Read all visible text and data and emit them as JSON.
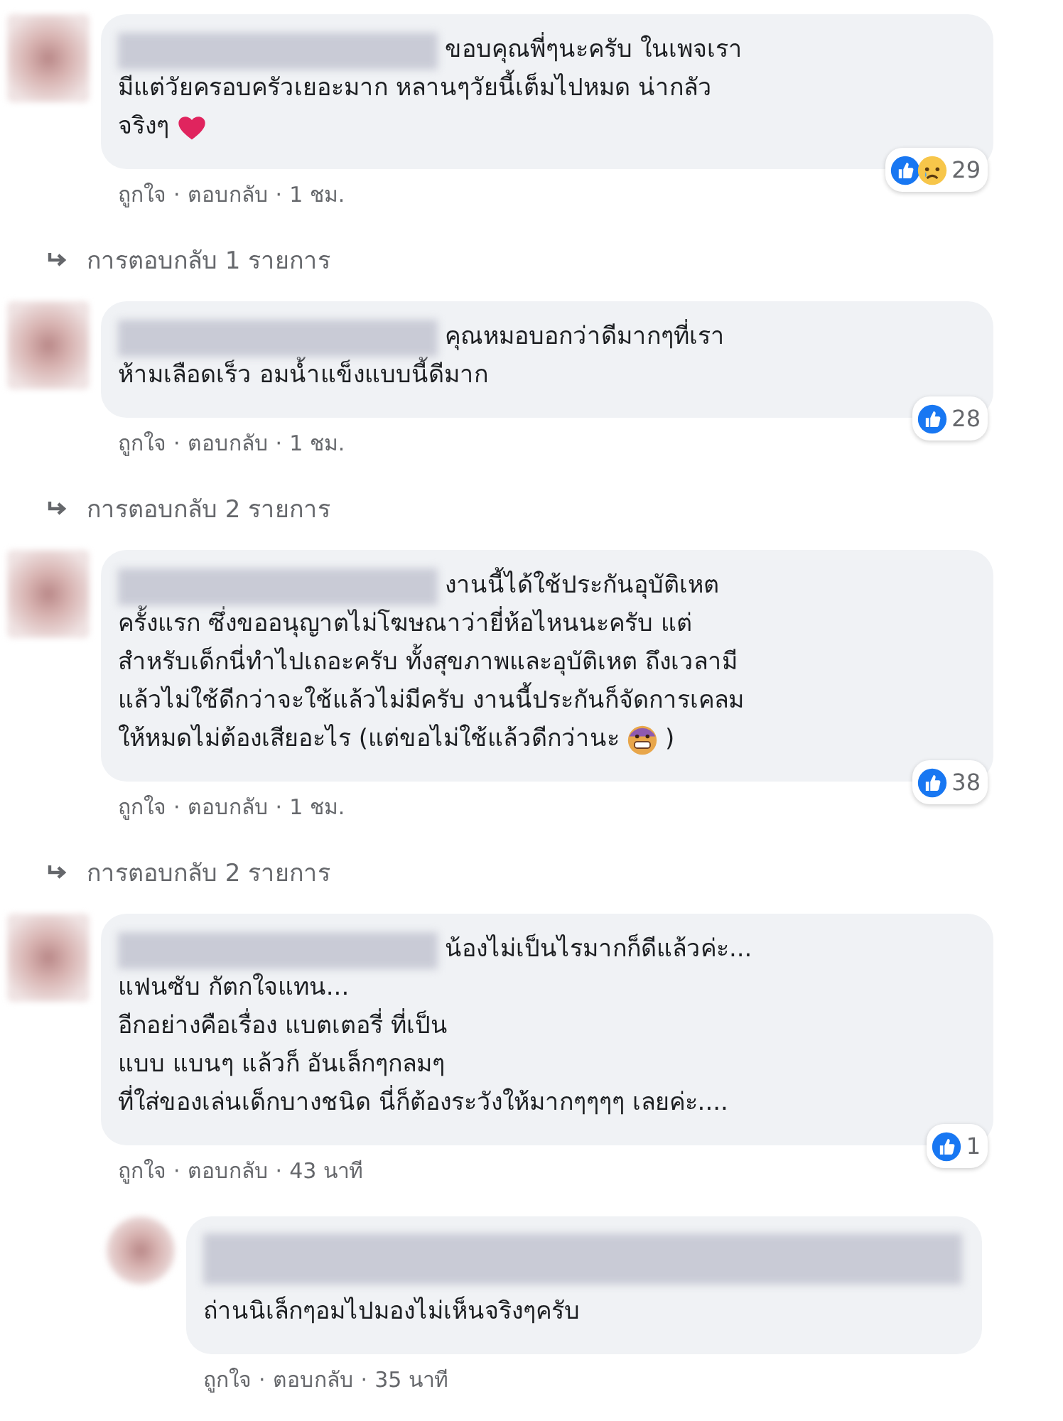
{
  "comments": [
    {
      "lines": [
        [
          {
            "kind": "text",
            "text": "ขอบคุณพี่ๆนะครับ ในเพจเรา"
          }
        ],
        [
          {
            "kind": "text",
            "text": "มีแต่วัยครอบครัวเยอะมาก หลานๆวัยนี้เต็มไปหมด น่ากลัว"
          }
        ],
        [
          {
            "kind": "text",
            "text": "จริงๆ"
          },
          {
            "kind": "heart"
          }
        ]
      ],
      "reactions": [
        {
          "kind": "like"
        },
        {
          "kind": "sad"
        }
      ],
      "reaction_count": "29",
      "like_link": "ถูกใจ",
      "reply_link": "ตอบกลับ",
      "time": "1 ชม.",
      "separator": "·",
      "replies_link": "การตอบกลับ 1 รายการ"
    },
    {
      "lines": [
        [
          {
            "kind": "text",
            "text": "คุณหมอบอกว่าดีมากๆที่เรา"
          }
        ],
        [
          {
            "kind": "text",
            "text": "ห้ามเลือดเร็ว อมน้ำแข็งแบบนี้ดีมาก"
          }
        ]
      ],
      "reactions": [
        {
          "kind": "like"
        }
      ],
      "reaction_count": "28",
      "like_link": "ถูกใจ",
      "reply_link": "ตอบกลับ",
      "time": "1 ชม.",
      "separator": "·",
      "replies_link": "การตอบกลับ 2 รายการ"
    },
    {
      "lines": [
        [
          {
            "kind": "text",
            "text": "งานนี้ได้ใช้ประกันอุบัติเหต"
          }
        ],
        [
          {
            "kind": "text",
            "text": "ครั้งแรก ซึ่งขออนุญาตไม่โฆษณาว่ายี่ห้อไหนนะครับ แต่"
          }
        ],
        [
          {
            "kind": "text",
            "text": "สำหรับเด็กนี่ทำไปเถอะครับ ทั้งสุขภาพและอุบัติเหต ถึงเวลามี"
          }
        ],
        [
          {
            "kind": "text",
            "text": "แล้วไม่ใช้ดีกว่าจะใช้แล้วไม่มีครับ งานนี้ประกันก็จัดการเคลม"
          }
        ],
        [
          {
            "kind": "text",
            "text": "ให้หมดไม่ต้องเสียอะไร (แต่ขอไม่ใช้แล้วดีกว่านะ"
          },
          {
            "kind": "grimace"
          },
          {
            "kind": "text",
            "text": ")"
          }
        ]
      ],
      "reactions": [
        {
          "kind": "like"
        }
      ],
      "reaction_count": "38",
      "like_link": "ถูกใจ",
      "reply_link": "ตอบกลับ",
      "time": "1 ชม.",
      "separator": "·",
      "replies_link": "การตอบกลับ 2 รายการ"
    },
    {
      "lines": [
        [
          {
            "kind": "text",
            "text": "น้องไม่เป็นไรมากก็ดีแล้วค่ะ..."
          }
        ],
        [
          {
            "kind": "text",
            "text": "แฟนซับ กัตกใจแทน..."
          }
        ],
        [
          {
            "kind": "text",
            "text": "อีกอย่างคือเรื่อง แบตเตอรี่ ที่เป็น"
          }
        ],
        [
          {
            "kind": "text",
            "text": "แบบ แบนๆ แล้วก็ อันเล็กๆกลมๆ"
          }
        ],
        [
          {
            "kind": "text",
            "text": "ที่ใส่ของเล่นเด็กบางชนิด นี่ก็ต้องระวังให้มากๆๆๆๆ เลยค่ะ...."
          }
        ]
      ],
      "reactions": [
        {
          "kind": "like"
        }
      ],
      "reaction_count": "1",
      "like_link": "ถูกใจ",
      "reply_link": "ตอบกลับ",
      "time": "43 นาที",
      "separator": "·",
      "replies": [
        {
          "lines": [
            [
              {
                "kind": "text",
                "text": "ถ่านนิเล็กๆอมไปมองไม่เห็นจริงๆครับ"
              }
            ]
          ],
          "like_link": "ถูกใจ",
          "reply_link": "ตอบกลับ",
          "time": "35 นาที",
          "separator": "·"
        }
      ]
    }
  ]
}
